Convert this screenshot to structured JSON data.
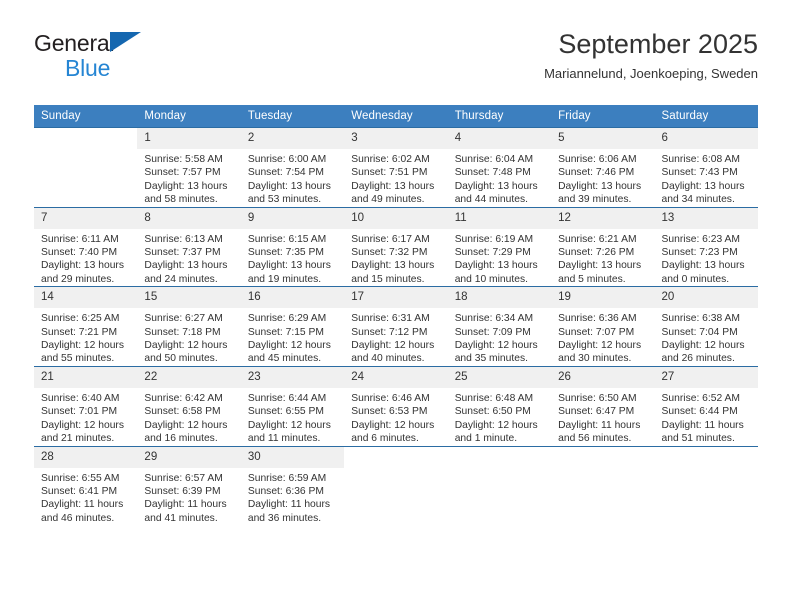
{
  "brand": {
    "name_top": "General",
    "name_bottom": "Blue",
    "triangle_color": "#1567b0",
    "blue_text_color": "#2585d3"
  },
  "header": {
    "title": "September 2025",
    "subtitle": "Mariannelund, Joenkoeping, Sweden"
  },
  "theme": {
    "header_bg": "#3c7fbf",
    "row_border": "#2b6ca3",
    "daynum_bg": "#f0f0f0",
    "text": "#333333"
  },
  "calendar": {
    "weekday_headers": [
      "Sunday",
      "Monday",
      "Tuesday",
      "Wednesday",
      "Thursday",
      "Friday",
      "Saturday"
    ],
    "labels": {
      "sunrise": "Sunrise:",
      "sunset": "Sunset:",
      "daylight": "Daylight:"
    },
    "weeks": [
      [
        {
          "day": "",
          "empty": true
        },
        {
          "day": "1",
          "sunrise": "Sunrise: 5:58 AM",
          "sunset": "Sunset: 7:57 PM",
          "daylight1": "Daylight: 13 hours",
          "daylight2": "and 58 minutes."
        },
        {
          "day": "2",
          "sunrise": "Sunrise: 6:00 AM",
          "sunset": "Sunset: 7:54 PM",
          "daylight1": "Daylight: 13 hours",
          "daylight2": "and 53 minutes."
        },
        {
          "day": "3",
          "sunrise": "Sunrise: 6:02 AM",
          "sunset": "Sunset: 7:51 PM",
          "daylight1": "Daylight: 13 hours",
          "daylight2": "and 49 minutes."
        },
        {
          "day": "4",
          "sunrise": "Sunrise: 6:04 AM",
          "sunset": "Sunset: 7:48 PM",
          "daylight1": "Daylight: 13 hours",
          "daylight2": "and 44 minutes."
        },
        {
          "day": "5",
          "sunrise": "Sunrise: 6:06 AM",
          "sunset": "Sunset: 7:46 PM",
          "daylight1": "Daylight: 13 hours",
          "daylight2": "and 39 minutes."
        },
        {
          "day": "6",
          "sunrise": "Sunrise: 6:08 AM",
          "sunset": "Sunset: 7:43 PM",
          "daylight1": "Daylight: 13 hours",
          "daylight2": "and 34 minutes."
        }
      ],
      [
        {
          "day": "7",
          "sunrise": "Sunrise: 6:11 AM",
          "sunset": "Sunset: 7:40 PM",
          "daylight1": "Daylight: 13 hours",
          "daylight2": "and 29 minutes."
        },
        {
          "day": "8",
          "sunrise": "Sunrise: 6:13 AM",
          "sunset": "Sunset: 7:37 PM",
          "daylight1": "Daylight: 13 hours",
          "daylight2": "and 24 minutes."
        },
        {
          "day": "9",
          "sunrise": "Sunrise: 6:15 AM",
          "sunset": "Sunset: 7:35 PM",
          "daylight1": "Daylight: 13 hours",
          "daylight2": "and 19 minutes."
        },
        {
          "day": "10",
          "sunrise": "Sunrise: 6:17 AM",
          "sunset": "Sunset: 7:32 PM",
          "daylight1": "Daylight: 13 hours",
          "daylight2": "and 15 minutes."
        },
        {
          "day": "11",
          "sunrise": "Sunrise: 6:19 AM",
          "sunset": "Sunset: 7:29 PM",
          "daylight1": "Daylight: 13 hours",
          "daylight2": "and 10 minutes."
        },
        {
          "day": "12",
          "sunrise": "Sunrise: 6:21 AM",
          "sunset": "Sunset: 7:26 PM",
          "daylight1": "Daylight: 13 hours",
          "daylight2": "and 5 minutes."
        },
        {
          "day": "13",
          "sunrise": "Sunrise: 6:23 AM",
          "sunset": "Sunset: 7:23 PM",
          "daylight1": "Daylight: 13 hours",
          "daylight2": "and 0 minutes."
        }
      ],
      [
        {
          "day": "14",
          "sunrise": "Sunrise: 6:25 AM",
          "sunset": "Sunset: 7:21 PM",
          "daylight1": "Daylight: 12 hours",
          "daylight2": "and 55 minutes."
        },
        {
          "day": "15",
          "sunrise": "Sunrise: 6:27 AM",
          "sunset": "Sunset: 7:18 PM",
          "daylight1": "Daylight: 12 hours",
          "daylight2": "and 50 minutes."
        },
        {
          "day": "16",
          "sunrise": "Sunrise: 6:29 AM",
          "sunset": "Sunset: 7:15 PM",
          "daylight1": "Daylight: 12 hours",
          "daylight2": "and 45 minutes."
        },
        {
          "day": "17",
          "sunrise": "Sunrise: 6:31 AM",
          "sunset": "Sunset: 7:12 PM",
          "daylight1": "Daylight: 12 hours",
          "daylight2": "and 40 minutes."
        },
        {
          "day": "18",
          "sunrise": "Sunrise: 6:34 AM",
          "sunset": "Sunset: 7:09 PM",
          "daylight1": "Daylight: 12 hours",
          "daylight2": "and 35 minutes."
        },
        {
          "day": "19",
          "sunrise": "Sunrise: 6:36 AM",
          "sunset": "Sunset: 7:07 PM",
          "daylight1": "Daylight: 12 hours",
          "daylight2": "and 30 minutes."
        },
        {
          "day": "20",
          "sunrise": "Sunrise: 6:38 AM",
          "sunset": "Sunset: 7:04 PM",
          "daylight1": "Daylight: 12 hours",
          "daylight2": "and 26 minutes."
        }
      ],
      [
        {
          "day": "21",
          "sunrise": "Sunrise: 6:40 AM",
          "sunset": "Sunset: 7:01 PM",
          "daylight1": "Daylight: 12 hours",
          "daylight2": "and 21 minutes."
        },
        {
          "day": "22",
          "sunrise": "Sunrise: 6:42 AM",
          "sunset": "Sunset: 6:58 PM",
          "daylight1": "Daylight: 12 hours",
          "daylight2": "and 16 minutes."
        },
        {
          "day": "23",
          "sunrise": "Sunrise: 6:44 AM",
          "sunset": "Sunset: 6:55 PM",
          "daylight1": "Daylight: 12 hours",
          "daylight2": "and 11 minutes."
        },
        {
          "day": "24",
          "sunrise": "Sunrise: 6:46 AM",
          "sunset": "Sunset: 6:53 PM",
          "daylight1": "Daylight: 12 hours",
          "daylight2": "and 6 minutes."
        },
        {
          "day": "25",
          "sunrise": "Sunrise: 6:48 AM",
          "sunset": "Sunset: 6:50 PM",
          "daylight1": "Daylight: 12 hours",
          "daylight2": "and 1 minute."
        },
        {
          "day": "26",
          "sunrise": "Sunrise: 6:50 AM",
          "sunset": "Sunset: 6:47 PM",
          "daylight1": "Daylight: 11 hours",
          "daylight2": "and 56 minutes."
        },
        {
          "day": "27",
          "sunrise": "Sunrise: 6:52 AM",
          "sunset": "Sunset: 6:44 PM",
          "daylight1": "Daylight: 11 hours",
          "daylight2": "and 51 minutes."
        }
      ],
      [
        {
          "day": "28",
          "sunrise": "Sunrise: 6:55 AM",
          "sunset": "Sunset: 6:41 PM",
          "daylight1": "Daylight: 11 hours",
          "daylight2": "and 46 minutes."
        },
        {
          "day": "29",
          "sunrise": "Sunrise: 6:57 AM",
          "sunset": "Sunset: 6:39 PM",
          "daylight1": "Daylight: 11 hours",
          "daylight2": "and 41 minutes."
        },
        {
          "day": "30",
          "sunrise": "Sunrise: 6:59 AM",
          "sunset": "Sunset: 6:36 PM",
          "daylight1": "Daylight: 11 hours",
          "daylight2": "and 36 minutes."
        },
        {
          "day": "",
          "empty": true
        },
        {
          "day": "",
          "empty": true
        },
        {
          "day": "",
          "empty": true
        },
        {
          "day": "",
          "empty": true
        }
      ]
    ]
  }
}
